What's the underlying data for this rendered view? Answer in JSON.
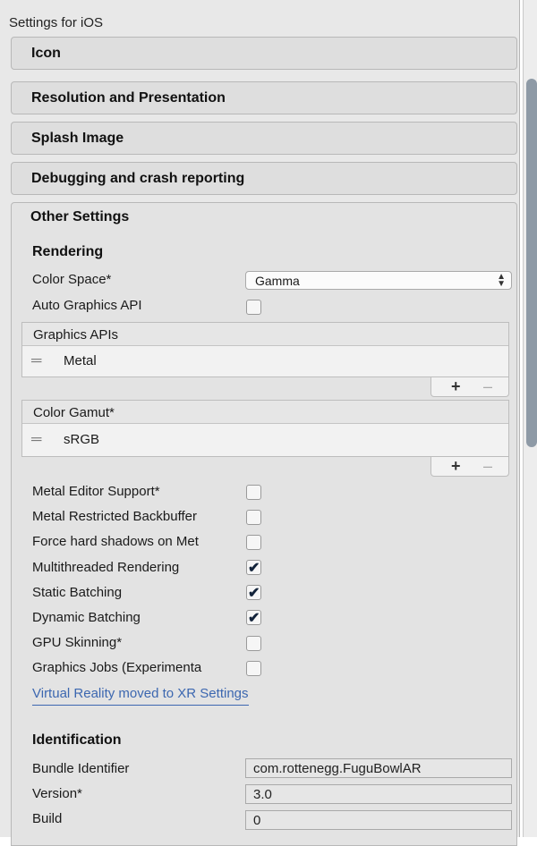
{
  "panel": {
    "title": "Settings for iOS"
  },
  "sections": {
    "icon": "Icon",
    "resolution": "Resolution and Presentation",
    "splash": "Splash Image",
    "debugging": "Debugging and crash reporting",
    "other": "Other Settings"
  },
  "rendering": {
    "heading": "Rendering",
    "color_space_label": "Color Space*",
    "color_space_value": "Gamma",
    "auto_graphics_label": "Auto Graphics API",
    "auto_graphics_checked": false,
    "graphics_apis": {
      "header": "Graphics APIs",
      "items": [
        "Metal"
      ],
      "plus": "+",
      "minus": "–"
    },
    "color_gamut": {
      "header": "Color Gamut*",
      "items": [
        "sRGB"
      ],
      "plus": "+",
      "minus": "–"
    },
    "toggles": [
      {
        "label": "Metal Editor Support*",
        "checked": false
      },
      {
        "label": "Metal Restricted Backbuffer",
        "checked": false
      },
      {
        "label": "Force hard shadows on Met",
        "checked": false
      },
      {
        "label": "Multithreaded Rendering",
        "checked": true
      },
      {
        "label": "Static Batching",
        "checked": true
      },
      {
        "label": "Dynamic Batching",
        "checked": true
      },
      {
        "label": "GPU Skinning*",
        "checked": false
      },
      {
        "label": "Graphics Jobs (Experimenta",
        "checked": false
      }
    ],
    "vr_link": "Virtual Reality moved to XR Settings"
  },
  "identification": {
    "heading": "Identification",
    "bundle_label": "Bundle Identifier",
    "bundle_value": "com.rottenegg.FuguBowlAR",
    "version_label": "Version*",
    "version_value": "3.0",
    "build_label": "Build",
    "build_value": "0"
  },
  "checkmark_glyph": "✔",
  "handle_glyph": "═"
}
